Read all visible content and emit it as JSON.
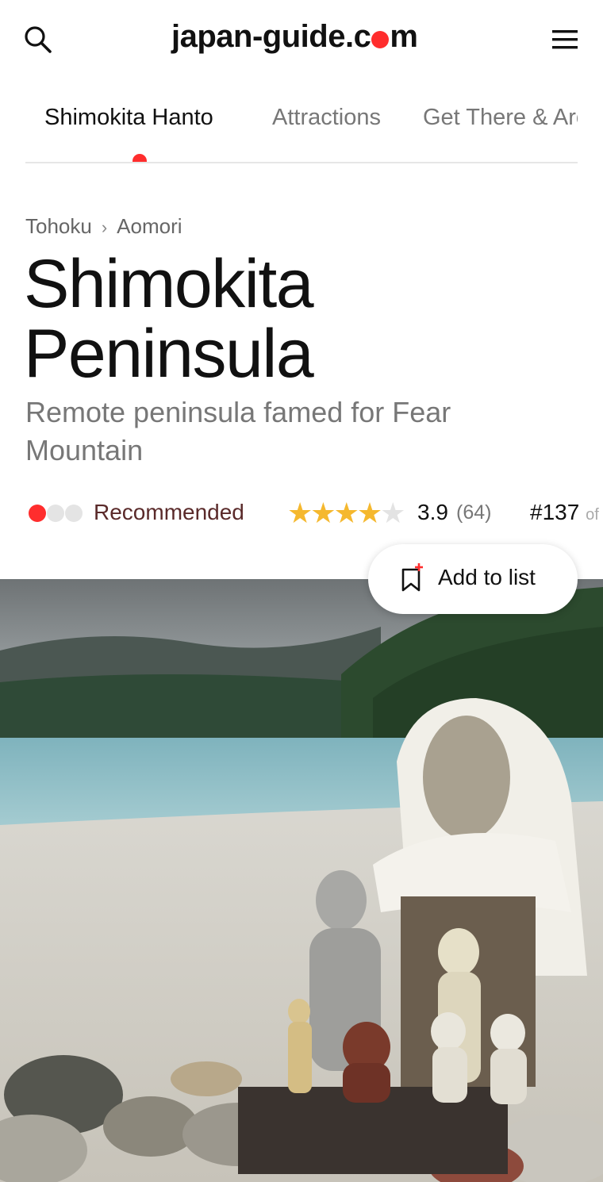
{
  "header": {
    "logo_prefix": "japan-guide.c",
    "logo_suffix": "m",
    "search_icon": "search-icon",
    "menu_icon": "hamburger-menu-icon"
  },
  "tabs": [
    {
      "label": "Shimokita Hanto",
      "active": true
    },
    {
      "label": "Attractions",
      "active": false
    },
    {
      "label": "Get There & Around",
      "active": false
    }
  ],
  "breadcrumb": {
    "items": [
      "Tohoku",
      "Aomori"
    ],
    "separator": "›"
  },
  "page": {
    "title_line1": "Shimokita",
    "title_line2": "Peninsula",
    "subtitle": "Remote peninsula famed for Fear Mountain"
  },
  "rating": {
    "recommendation_level": 1,
    "recommendation_max": 3,
    "recommendation_label": "Recommended",
    "stars": 3.9,
    "stars_max": 5,
    "score": "3.9",
    "count": "(64)",
    "rank": "#137",
    "rank_suffix": "of"
  },
  "actions": {
    "add_to_list_label": "Add to list",
    "add_to_list_icon": "bookmark-plus-icon"
  },
  "hero_image": {
    "description_icon": "photo-jizo-statues-lakeshore"
  },
  "colors": {
    "accent": "#ff2d2d",
    "star": "#f5b82e",
    "recommended_text": "#5a2a2a",
    "muted_text": "#777777"
  }
}
